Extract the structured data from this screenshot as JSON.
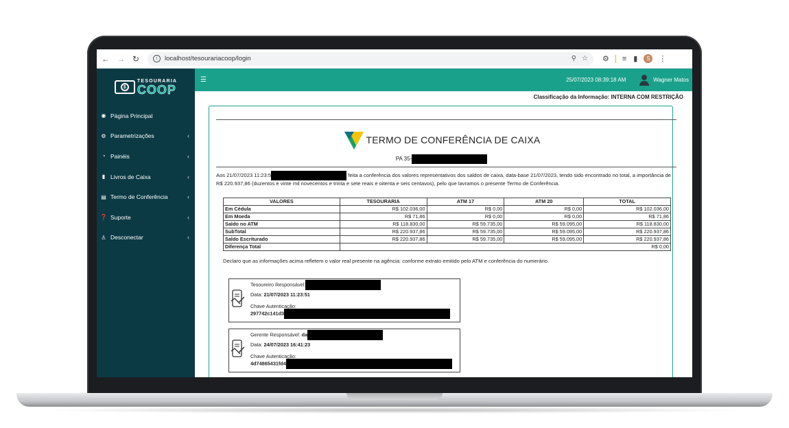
{
  "browser": {
    "url": "localhost/tesourariacoop/login",
    "profile_initial": "S"
  },
  "brand": {
    "line1": "TESOURARIA",
    "line2": "COOP"
  },
  "sidebar": {
    "items": [
      {
        "label": "Página Principal",
        "icon": "dashboard-icon",
        "has_submenu": false
      },
      {
        "label": "Parametrizações",
        "icon": "gears-icon",
        "has_submenu": true
      },
      {
        "label": "Painéis",
        "icon": "pie-chart-icon",
        "has_submenu": true
      },
      {
        "label": "Livros de Caixa",
        "icon": "book-icon",
        "has_submenu": true
      },
      {
        "label": "Termo de Conferência",
        "icon": "document-icon",
        "has_submenu": true
      },
      {
        "label": "Suporte",
        "icon": "question-icon",
        "has_submenu": true
      },
      {
        "label": "Desconectar",
        "icon": "user-icon",
        "has_submenu": true
      }
    ]
  },
  "topbar": {
    "datetime": "25/07/2023 08:39:18 AM",
    "user_name": "Wagner Matos"
  },
  "classification": "Classificação da Informação: INTERNA COM RESTRIÇÃO",
  "document": {
    "title": "TERMO DE CONFERÊNCIA DE CAIXA",
    "pa_label": "PA 35-",
    "para_part1": "Aos 21/07/2023 11:23:5",
    "para_part2": " feita a conferência dos valores representativos dos saldos de caixa, data-base 21/07/2023, tendo sido encontrado no total, a importância de R$ 220.937,86 (duzentos e vinte mil novecentos e trinta e sete reais e oitenta e seis centavos), pelo que lavramos o presente Termo de Conferência.",
    "table": {
      "headers": [
        "VALORES",
        "TESOURARIA",
        "ATM 17",
        "ATM 20",
        "TOTAL"
      ],
      "rows": [
        [
          "Em Cédula",
          "R$ 102.036,00",
          "R$ 0,00",
          "R$ 0,00",
          "R$ 102.036,00"
        ],
        [
          "Em Moeda",
          "R$ 71,86",
          "R$ 0,00",
          "R$ 0,00",
          "R$ 71,86"
        ],
        [
          "Saldo no ATM",
          "R$ 118.830,00",
          "R$ 59.735,00",
          "R$ 59.095,00",
          "R$ 118.830,00"
        ],
        [
          "SubTotal",
          "R$ 220.937,86",
          "R$ 59.735,00",
          "R$ 59.095,00",
          "R$ 220.937,86"
        ],
        [
          "Saldo Escriturado",
          "R$ 220.937,86",
          "R$ 59.735,00",
          "R$ 59.095,00",
          "R$ 220.937,86"
        ]
      ],
      "diff_label": "Diferença Total",
      "diff_value": "R$ 0,00"
    },
    "declaration": "Declaro que as informações acima refletem o valor real presente na agência: conforme extrato emitido pelo ATM e conferência do numerário.",
    "signatures": [
      {
        "role_label": "Tesoureiro Responsável:",
        "role_value": "",
        "date_label": "Data:",
        "date_value": "21/07/2023 11:23:51",
        "key_label": "Chave Autenticação:",
        "key_value": "297742c141d3"
      },
      {
        "role_label": "Gerente Responsável:",
        "role_value": "da",
        "date_label": "Data:",
        "date_value": "24/07/2023 16:41:23",
        "key_label": "Chave Autenticação:",
        "key_value": "4d74865431fd4"
      }
    ]
  },
  "colors": {
    "sidebar": "#0b3a45",
    "topbar": "#1aa18c",
    "brand_accent": "#19b7a3"
  }
}
